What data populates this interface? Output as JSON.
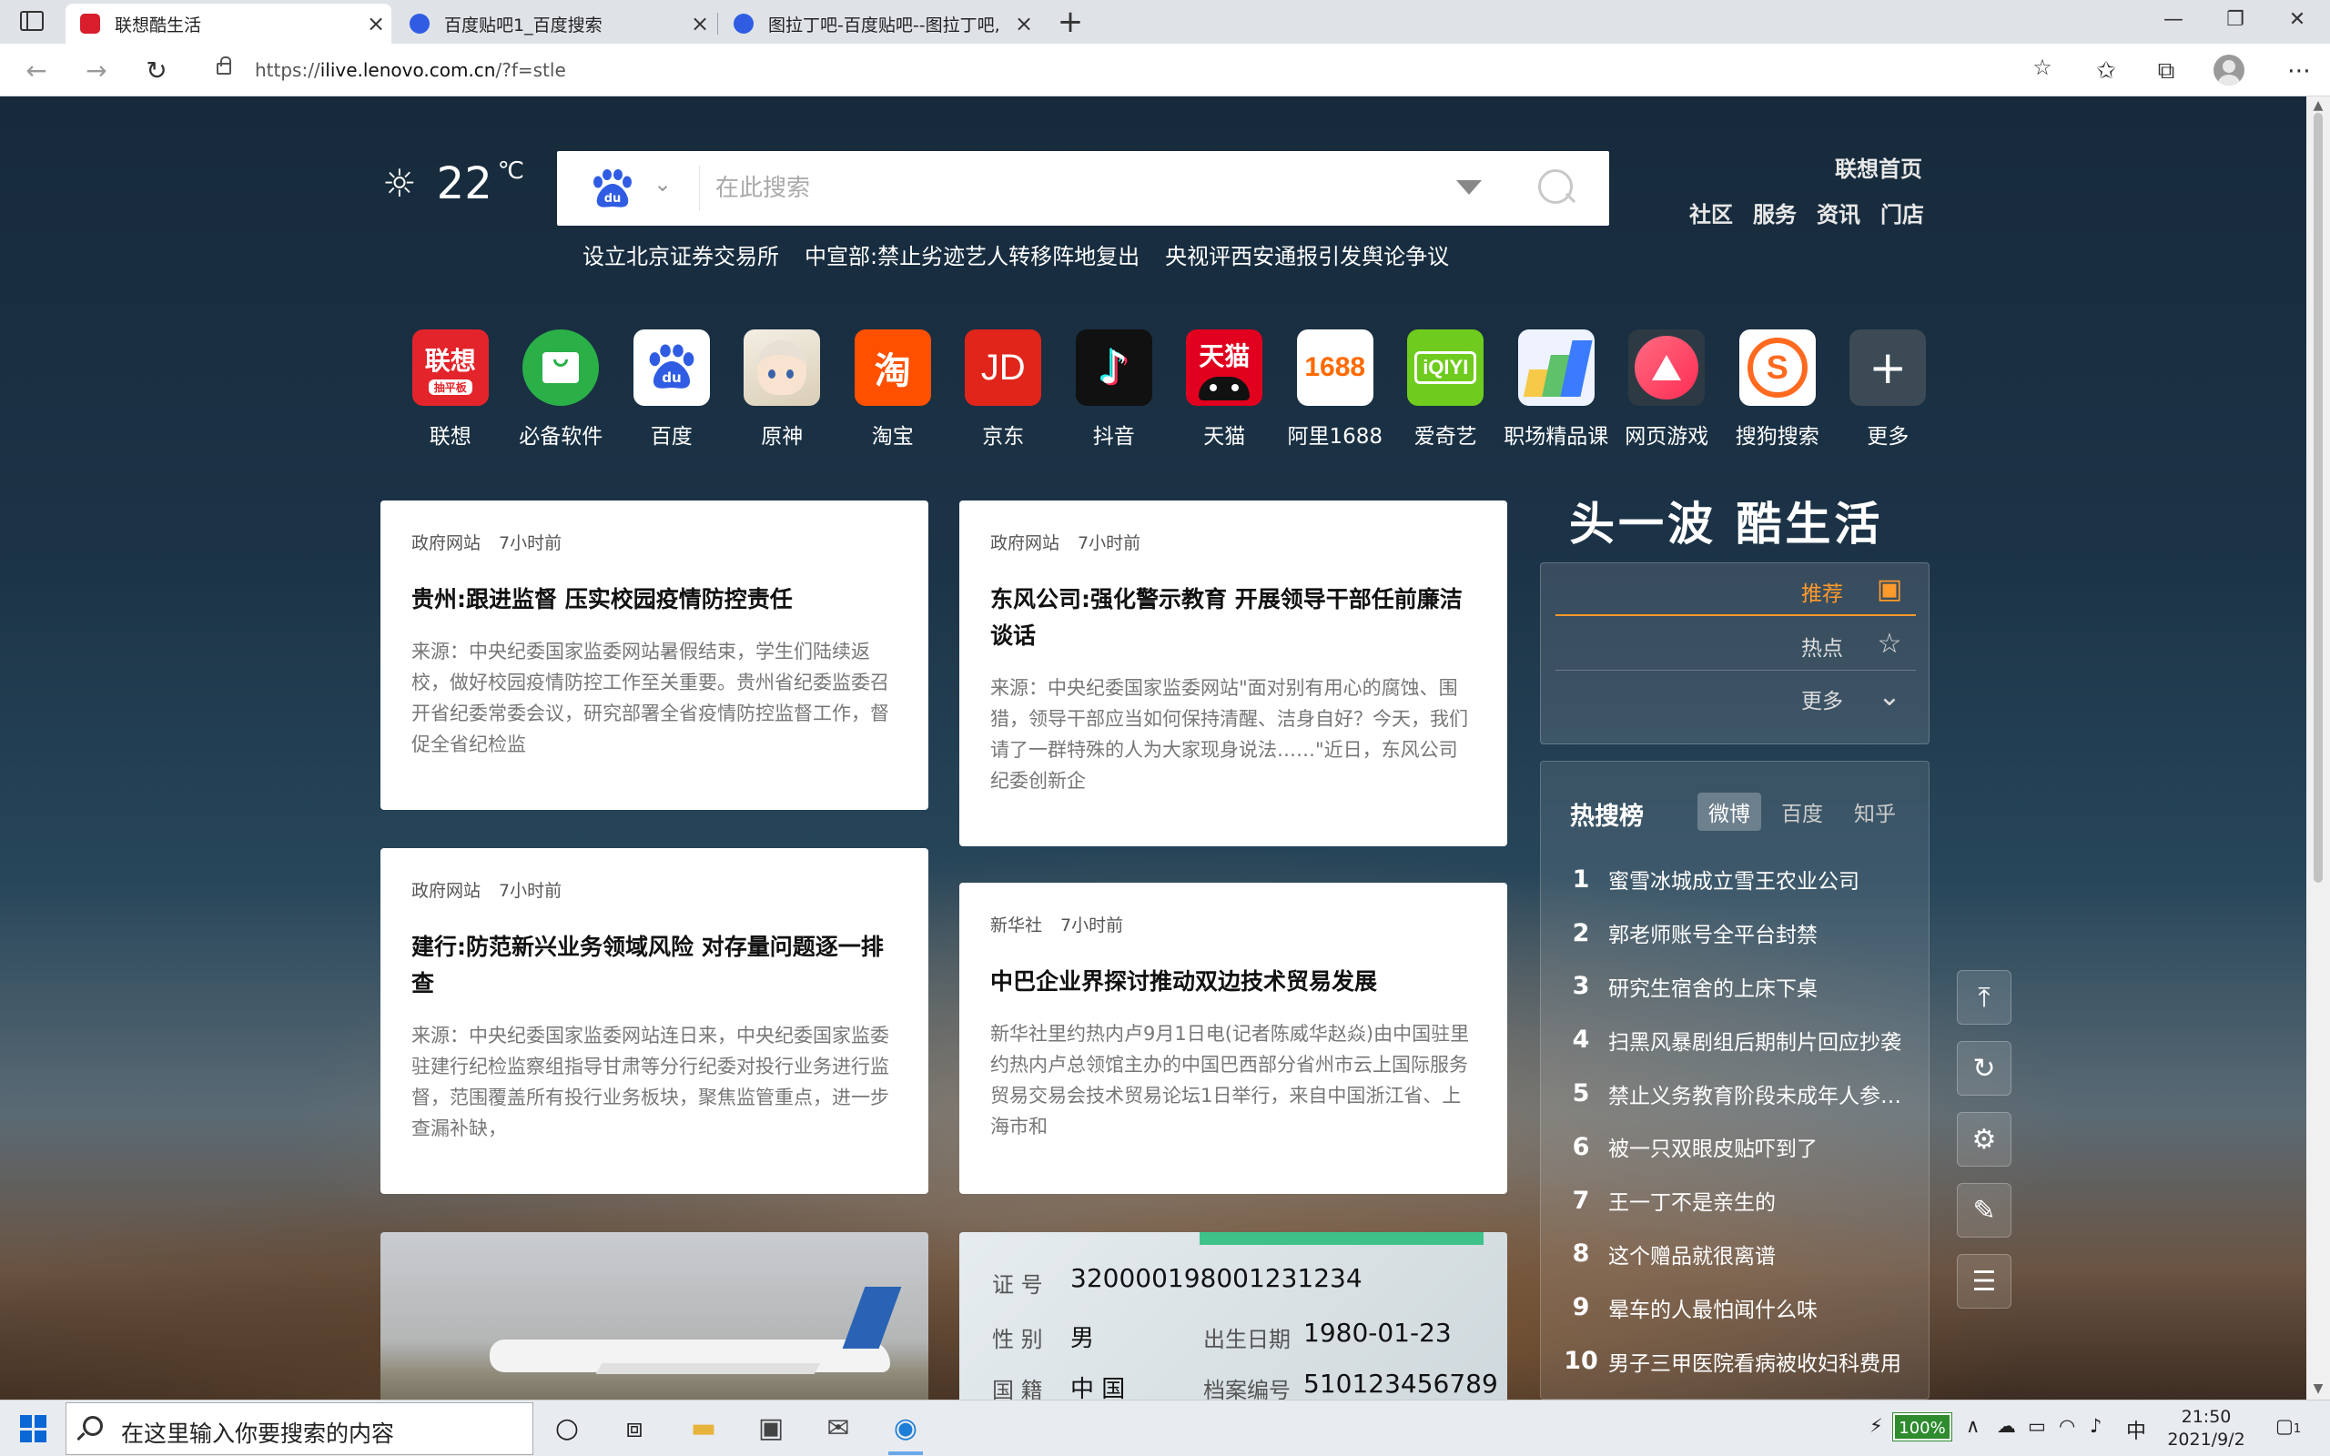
{
  "browser": {
    "tabs": [
      {
        "label": "联想酷生活",
        "active": true
      },
      {
        "label": "百度贴吧1_百度搜索",
        "active": false
      },
      {
        "label": "图拉丁吧-百度贴吧--图拉丁吧, ",
        "active": false
      }
    ],
    "url_prefix": "https://",
    "url_host": "ilive.lenovo.com.cn",
    "url_path": "/?f=stle"
  },
  "weather": {
    "temp": "22",
    "unit": "℃"
  },
  "search": {
    "placeholder": "在此搜索",
    "hot_links": [
      "设立北京证券交易所",
      "中宣部:禁止劣迹艺人转移阵地复出",
      "央视评西安通报引发舆论争议"
    ]
  },
  "lenovo_nav": {
    "home": "联想首页",
    "links": [
      "社区",
      "服务",
      "资讯",
      "门店"
    ]
  },
  "apps": [
    {
      "label": "联想",
      "icon_text": "联想",
      "sub": "抽平板",
      "bg": "#e3242b"
    },
    {
      "label": "必备软件",
      "icon_text": "",
      "bg": "#2bb048"
    },
    {
      "label": "百度",
      "icon_text": "du",
      "bg": "#ffffff"
    },
    {
      "label": "原神",
      "icon_text": "",
      "bg": "#e9e3d6"
    },
    {
      "label": "淘宝",
      "icon_text": "淘",
      "bg": "#ff5000"
    },
    {
      "label": "京东",
      "icon_text": "JD",
      "bg": "#e1251b"
    },
    {
      "label": "抖音",
      "icon_text": "♪",
      "bg": "#111111"
    },
    {
      "label": "天猫",
      "icon_text": "天猫",
      "bg": "#e1001e"
    },
    {
      "label": "阿里1688",
      "icon_text": "1688",
      "bg": "#ff6a00"
    },
    {
      "label": "爱奇艺",
      "icon_text": "iQIYI",
      "bg": "#6fcc1e"
    },
    {
      "label": "职场精品课",
      "icon_text": "",
      "bg": "#e9f1ff"
    },
    {
      "label": "网页游戏",
      "icon_text": "",
      "bg": "#ff3d5a"
    },
    {
      "label": "搜狗搜索",
      "icon_text": "S",
      "bg": "#ffffff"
    },
    {
      "label": "更多",
      "icon_text": "+",
      "bg": "#3b4a55"
    }
  ],
  "news": [
    {
      "source": "政府网站",
      "time": "7小时前",
      "title": "贵州:跟进监督 压实校园疫情防控责任",
      "desc": "来源：中央纪委国家监委网站暑假结束，学生们陆续返校，做好校园疫情防控工作至关重要。贵州省纪委监委召开省纪委常委会议，研究部署全省疫情防控监督工作，督促全省纪检监"
    },
    {
      "source": "政府网站",
      "time": "7小时前",
      "title": "东风公司:强化警示教育 开展领导干部任前廉洁谈话",
      "desc": "来源：中央纪委国家监委网站\"面对别有用心的腐蚀、围猎，领导干部应当如何保持清醒、洁身自好？今天，我们请了一群特殊的人为大家现身说法……\"近日，东风公司纪委创新企"
    },
    {
      "source": "政府网站",
      "time": "7小时前",
      "title": "建行:防范新兴业务领域风险 对存量问题逐一排查",
      "desc": "来源：中央纪委国家监委网站连日来，中央纪委国家监委驻建行纪检监察组指导甘肃等分行纪委对投行业务进行监督，范围覆盖所有投行业务板块，聚焦监管重点，进一步查漏补缺，"
    },
    {
      "source": "新华社",
      "time": "7小时前",
      "title": "中巴企业界探讨推动双边技术贸易发展",
      "desc": "新华社里约热内卢9月1日电(记者陈威华赵焱)由中国驻里约热内卢总领馆主办的中国巴西部分省州市云上国际服务贸易交易会技术贸易论坛1日举行，来自中国浙江省、上海市和"
    }
  ],
  "idcard": {
    "number_label": "证  号",
    "number": "320000198001231234",
    "sex_label": "性  别",
    "sex": "男",
    "dob_label": "出生日期",
    "dob": "1980-01-23",
    "nation_label": "国  籍",
    "nation": "中  国",
    "file_label": "档案编号",
    "file_no": "510123456789"
  },
  "side": {
    "brand": "头一波 酷生活",
    "categories": [
      {
        "label": "推荐",
        "icon": "calendar-icon",
        "active": true
      },
      {
        "label": "热点",
        "icon": "star-icon",
        "active": false
      },
      {
        "label": "更多",
        "icon": "double-chevron-down-icon",
        "active": false
      }
    ],
    "hot": {
      "title": "热搜榜",
      "tabs": [
        "微博",
        "百度",
        "知乎"
      ],
      "items": [
        {
          "rank": "1",
          "text": "蜜雪冰城成立雪王农业公司"
        },
        {
          "rank": "2",
          "text": "郭老师账号全平台封禁"
        },
        {
          "rank": "3",
          "text": "研究生宿舍的上床下桌"
        },
        {
          "rank": "4",
          "text": "扫黑风暴剧组后期制片回应抄袭"
        },
        {
          "rank": "5",
          "text": "禁止义务教育阶段未成年人参加商业性"
        },
        {
          "rank": "6",
          "text": "被一只双眼皮贴吓到了"
        },
        {
          "rank": "7",
          "text": "王一丁不是亲生的"
        },
        {
          "rank": "8",
          "text": "这个赠品就很离谱"
        },
        {
          "rank": "9",
          "text": "晕车的人最怕闻什么味"
        },
        {
          "rank": "10",
          "text": "男子三甲医院看病被收妇科费用"
        }
      ]
    }
  },
  "taskbar": {
    "search_placeholder": "在这里输入你要搜索的内容",
    "battery": "100%",
    "ime": "中",
    "time": "21:50",
    "date": "2021/9/2",
    "notif_count": "1"
  }
}
